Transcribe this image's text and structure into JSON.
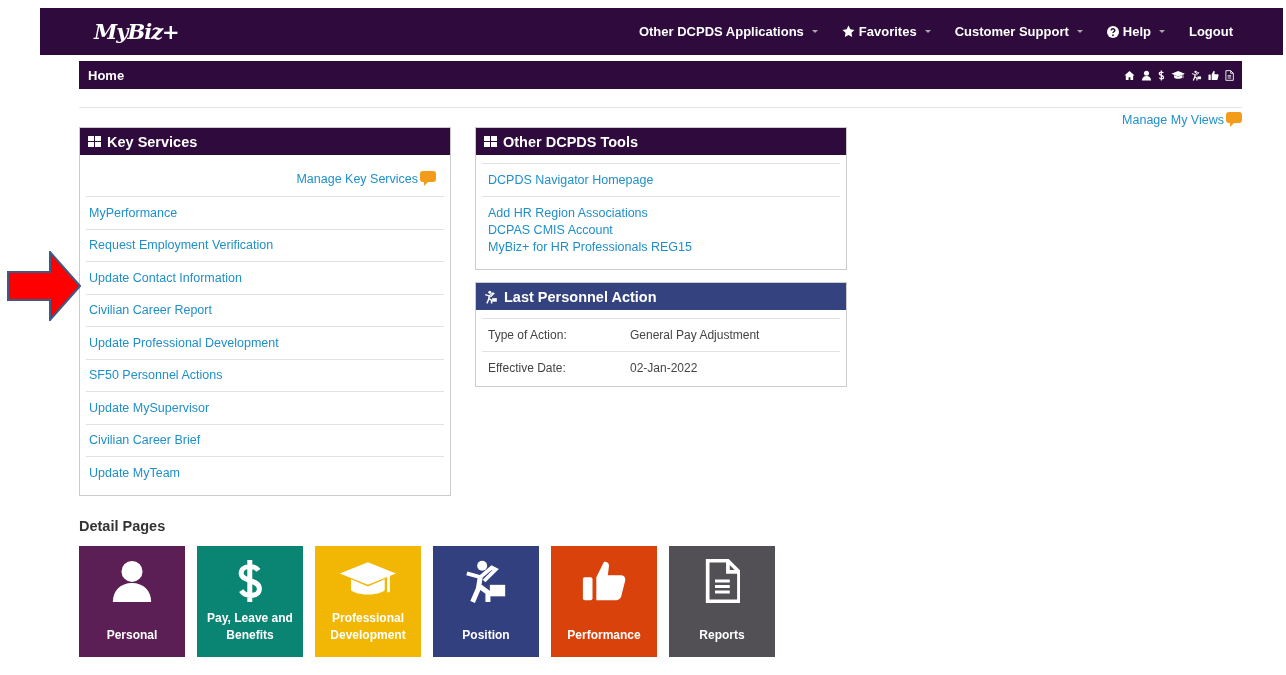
{
  "navbar": {
    "logo": "MyBiz+",
    "items": [
      {
        "label": "Other DCPDS Applications",
        "kind": "dropdown"
      },
      {
        "label": "Favorites",
        "kind": "dropdown"
      },
      {
        "label": "Customer Support",
        "kind": "dropdown"
      },
      {
        "label": "Help",
        "kind": "dropdown"
      },
      {
        "label": "Logout",
        "kind": "link"
      }
    ]
  },
  "page_bar": {
    "title": "Home"
  },
  "manage_views": "Manage My Views",
  "key_services": {
    "title": "Key Services",
    "manage": "Manage Key Services",
    "links": [
      "MyPerformance",
      "Request Employment Verification",
      "Update Contact Information",
      "Civilian Career Report",
      "Update Professional Development",
      "SF50 Personnel Actions",
      "Update MySupervisor",
      "Civilian Career Brief",
      "Update MyTeam"
    ]
  },
  "other_tools": {
    "title": "Other DCPDS Tools",
    "groups": [
      [
        "DCPDS Navigator Homepage"
      ],
      [
        "Add HR Region Associations",
        "DCPAS CMIS Account",
        "MyBiz+ for HR Professionals REG15"
      ]
    ]
  },
  "last_action": {
    "title": "Last Personnel Action",
    "rows": [
      {
        "label": "Type of Action:",
        "value": "General Pay Adjustment"
      },
      {
        "label": "Effective Date:",
        "value": "02-Jan-2022"
      }
    ]
  },
  "detail_pages": {
    "title": "Detail Pages",
    "tiles": [
      {
        "label": "Personal",
        "color": "#5b1f55"
      },
      {
        "label": "Pay, Leave and Benefits",
        "color": "#0b8573"
      },
      {
        "label": "Professional Development",
        "color": "#f2b705"
      },
      {
        "label": "Position",
        "color": "#33407f"
      },
      {
        "label": "Performance",
        "color": "#d9420b"
      },
      {
        "label": "Reports",
        "color": "#525055"
      }
    ]
  }
}
